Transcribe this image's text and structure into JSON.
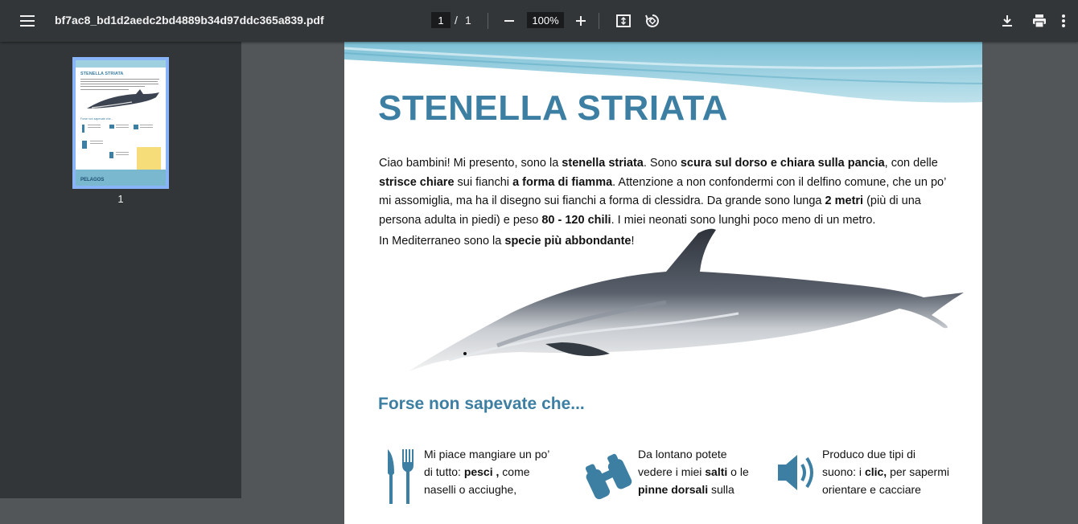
{
  "toolbar": {
    "filename": "bf7ac8_bd1d2aedc2bd4889b34d97ddc365a839.pdf",
    "page_current": "1",
    "page_separator": "/",
    "page_total": "1",
    "zoom": "100%"
  },
  "sidebar": {
    "thumbnail_page_number": "1"
  },
  "document": {
    "title": "STENELLA STRIATA",
    "intro": [
      {
        "t": "Ciao bambini! Mi presento, sono la ",
        "b": false
      },
      {
        "t": "stenella striata",
        "b": true
      },
      {
        "t": ". Sono ",
        "b": false
      },
      {
        "t": "scura sul dorso e chiara sulla pancia",
        "b": true
      },
      {
        "t": ", con delle ",
        "b": false
      },
      {
        "t": "strisce chiare",
        "b": true
      },
      {
        "t": " sui fianchi ",
        "b": false
      },
      {
        "t": "a forma di fiamma",
        "b": true
      },
      {
        "t": ". Attenzione a non confondermi con il delfino comune, che un po’ mi assomiglia, ma ha il disegno sui fianchi a forma di clessidra. Da grande sono lunga ",
        "b": false
      },
      {
        "t": "2 metri",
        "b": true
      },
      {
        "t": " (più di una persona adulta in piedi) e peso ",
        "b": false
      },
      {
        "t": "80 - 120 chili",
        "b": true
      },
      {
        "t": ". I miei neonati sono lunghi poco meno di un metro.",
        "b": false
      }
    ],
    "intro2": [
      {
        "t": "In Mediterraneo  sono la ",
        "b": false
      },
      {
        "t": "specie più abbondante",
        "b": true
      },
      {
        "t": "!",
        "b": false
      }
    ],
    "subtitle": "Forse non sapevate che...",
    "columns": [
      {
        "icon": "fork-knife-icon",
        "lines": [
          [
            {
              "t": "Mi piace mangiare un po’",
              "b": false
            }
          ],
          [
            {
              "t": "di tutto: ",
              "b": false
            },
            {
              "t": "pesci ,",
              "b": true
            },
            {
              "t": " come",
              "b": false
            }
          ],
          [
            {
              "t": "naselli o acciughe,",
              "b": false
            }
          ]
        ]
      },
      {
        "icon": "binoculars-icon",
        "lines": [
          [
            {
              "t": "Da lontano potete",
              "b": false
            }
          ],
          [
            {
              "t": "vedere i miei ",
              "b": false
            },
            {
              "t": "salti",
              "b": true
            },
            {
              "t": " o le",
              "b": false
            }
          ],
          [
            {
              "t": "pinne dorsali",
              "b": true
            },
            {
              "t": " sulla",
              "b": false
            }
          ]
        ]
      },
      {
        "icon": "speaker-icon",
        "lines": [
          [
            {
              "t": "Produco due tipi di",
              "b": false
            }
          ],
          [
            {
              "t": "suono: i ",
              "b": false
            },
            {
              "t": "clic,",
              "b": true
            },
            {
              "t": " per sapermi",
              "b": false
            }
          ],
          [
            {
              "t": "orientare e cacciare",
              "b": false
            }
          ]
        ]
      }
    ]
  },
  "colors": {
    "toolbar": "#323639",
    "viewer_bg": "#525659",
    "title_blue": "#3d7fa3",
    "thumb_border": "#8ab4f8"
  },
  "thumbnail_text": {
    "title": "STENELLA STRIATA",
    "section": "Forse non sapevate che...",
    "logo": "PELAGOS"
  }
}
